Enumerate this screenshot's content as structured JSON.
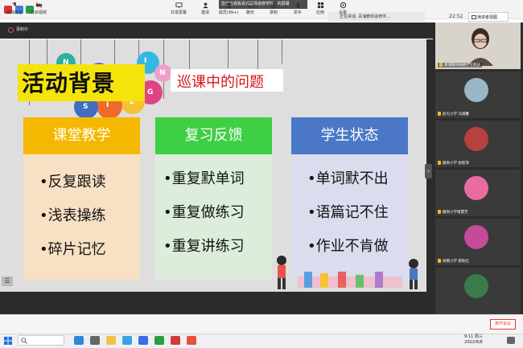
{
  "topbar": {
    "share_banner": "您正在观看青浦教师进修学院...的屏幕",
    "speaking": "正在讲话: 青浦教师进修学...",
    "time": "22:52",
    "view_button": "演讲者视图"
  },
  "recording": {
    "label": "录制中"
  },
  "slide": {
    "title": "活动背景",
    "subtitle": "巡课中的问题",
    "balloon_letters": [
      "I",
      "N",
      "G",
      "L",
      "I",
      "S",
      "H",
      "E",
      "N"
    ],
    "columns": [
      {
        "header": "课堂教学",
        "items": [
          "•反复跟读",
          "•浅表操练",
          "•碎片记忆"
        ]
      },
      {
        "header": "复习反馈",
        "items": [
          "•重复默单词",
          "•重复做练习",
          "•重复讲练习"
        ]
      },
      {
        "header": "学生状态",
        "items": [
          "•单词默不出",
          "•语篇记不住",
          "•作业不肯做"
        ]
      }
    ]
  },
  "participants": [
    {
      "name": "青浦教师进修学院教研"
    },
    {
      "name": "赵屯小学 马雨馨"
    },
    {
      "name": "徽商小学 张睦萍"
    },
    {
      "name": "徽商小学谢慧芳"
    },
    {
      "name": "尚模小学 蒋秋红"
    },
    {
      "name": ""
    }
  ],
  "toolbar": {
    "items": [
      "解除静音",
      "开启视频",
      "共享屏幕",
      "邀请",
      "成员(99+)",
      "聊天",
      "录制",
      "举手",
      "应用",
      "设置"
    ],
    "end_button": "离开会议"
  },
  "taskbar": {
    "time": "9:11 周三",
    "date": "2022/6/8"
  },
  "colors": {
    "title_bg": "#f5e40a",
    "subtitle_text": "#d6141a",
    "col1_header": "#f5b800",
    "col2_header": "#3fcf44",
    "col3_header": "#4a78c6",
    "end_button": "#e53935"
  }
}
